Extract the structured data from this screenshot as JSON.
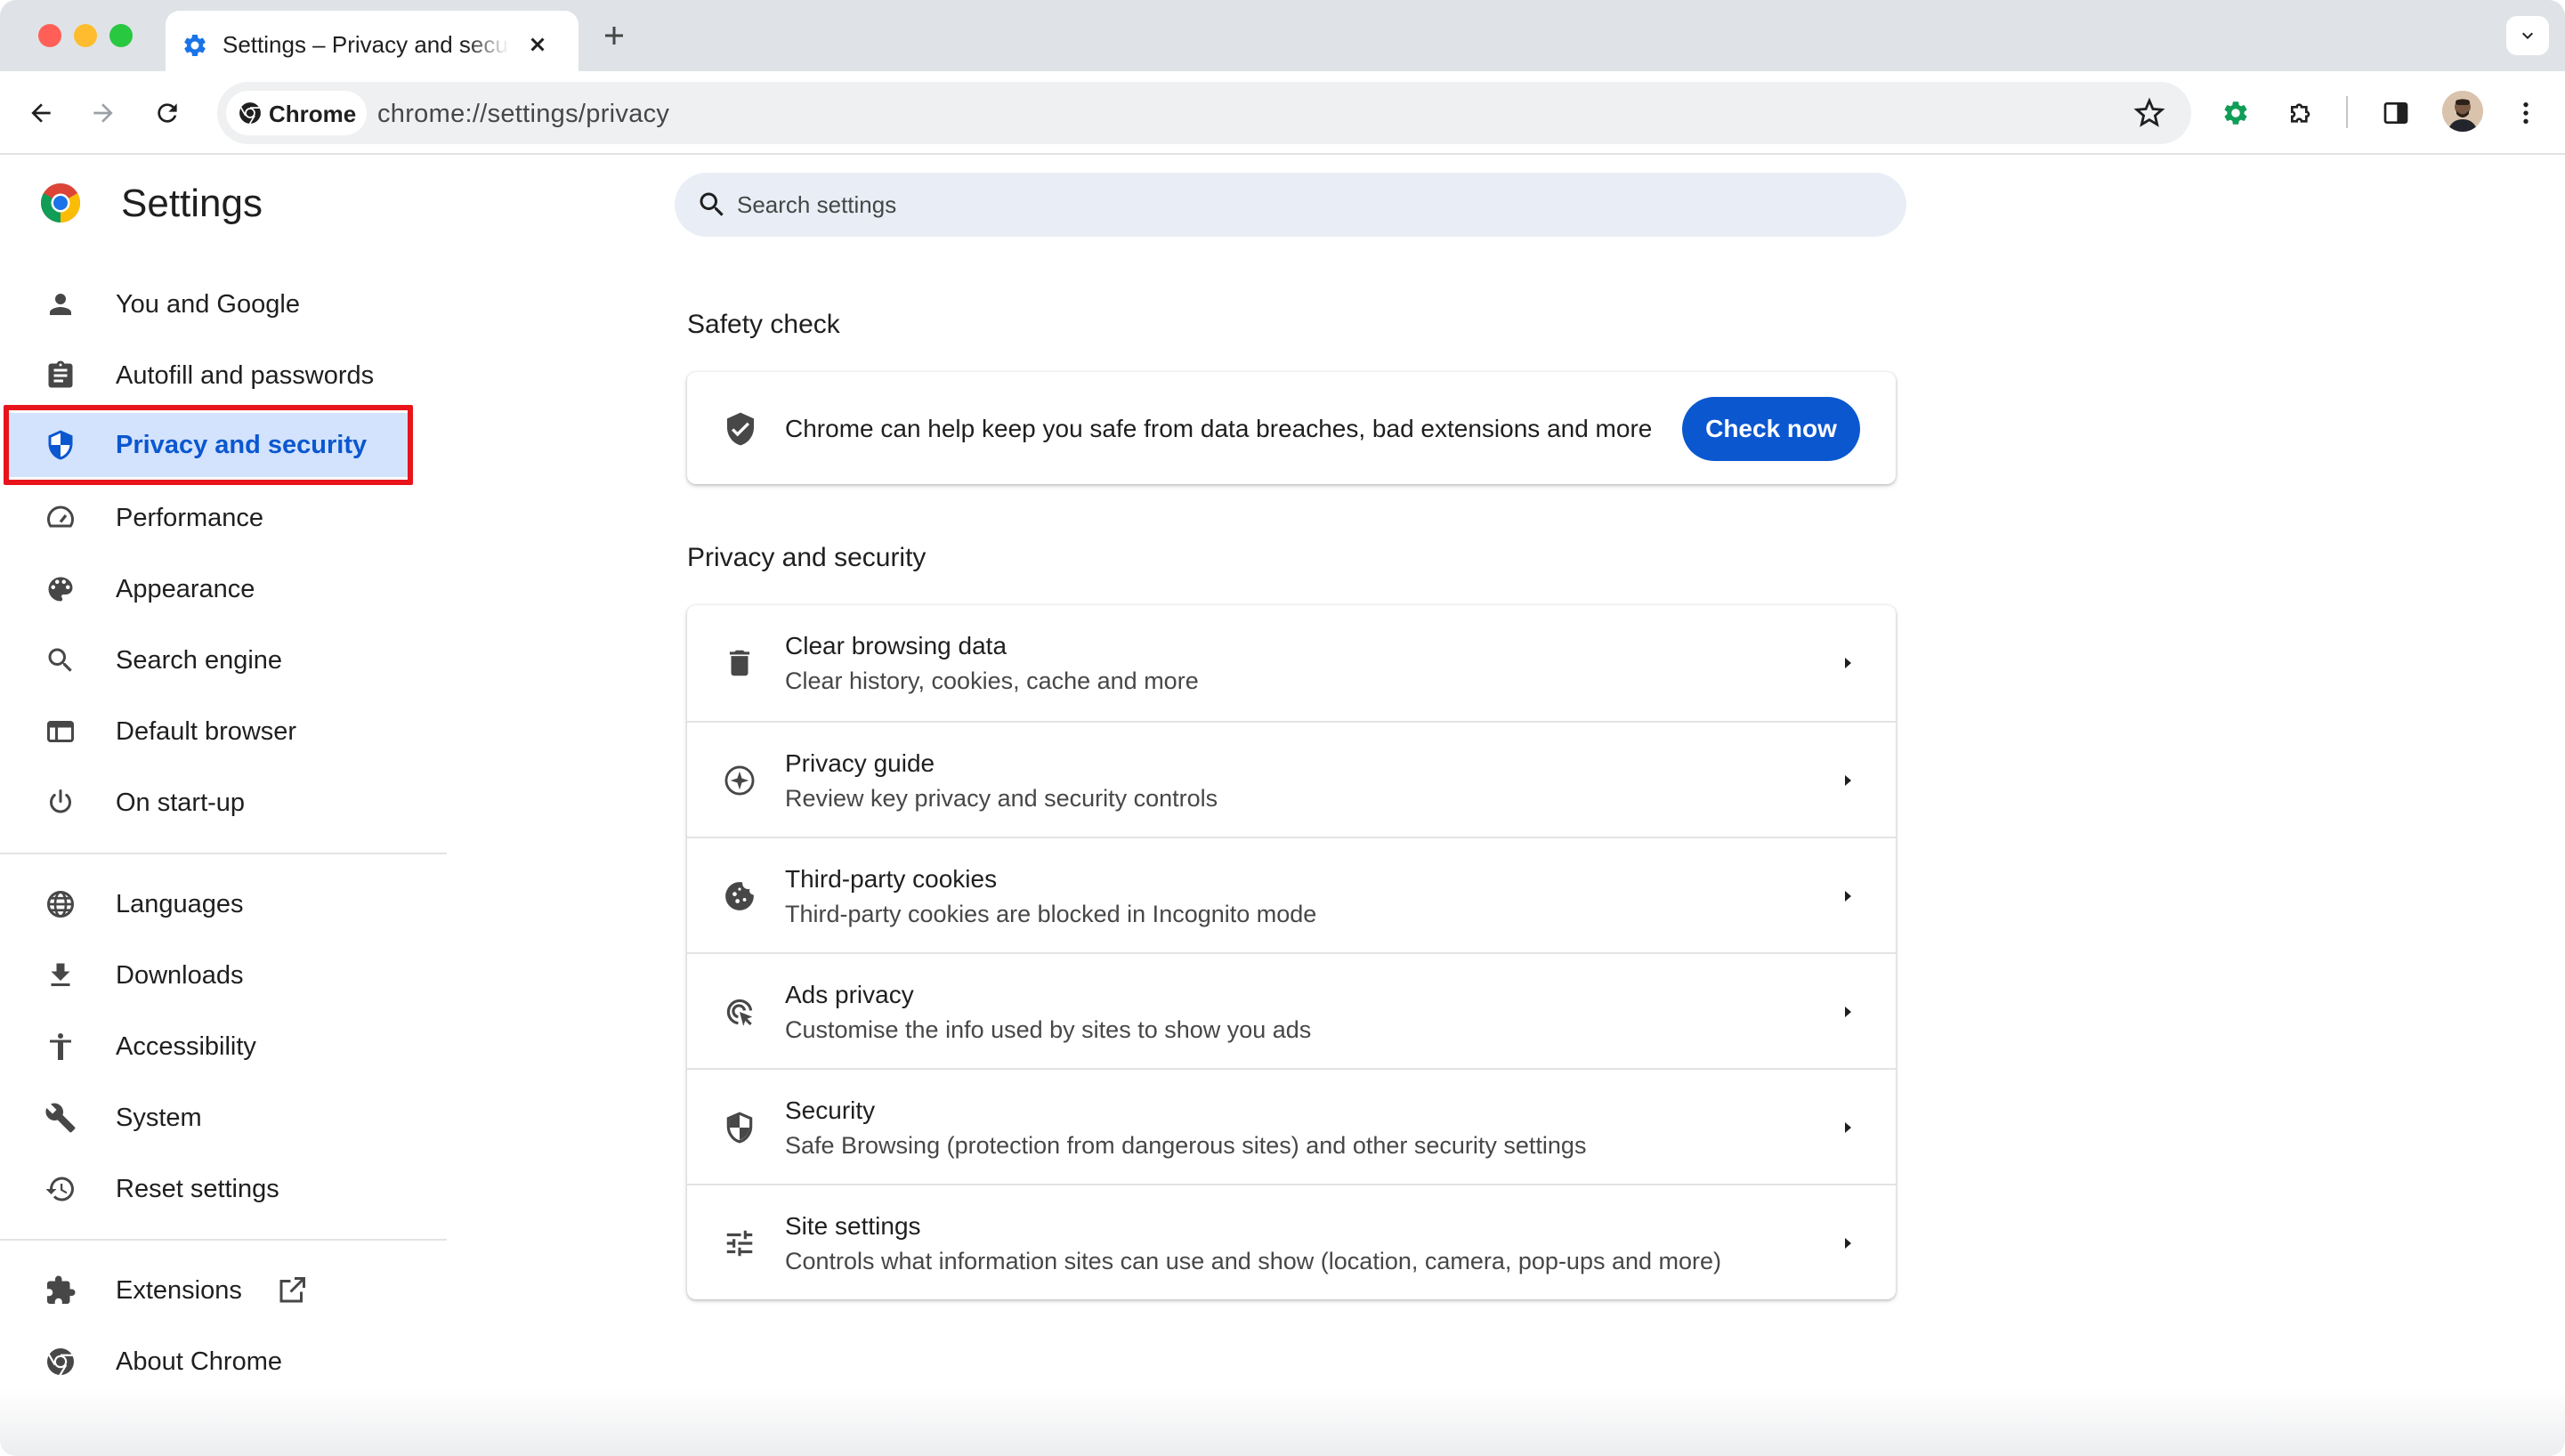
{
  "browser": {
    "tab_title": "Settings – Privacy and security",
    "address_chip": "Chrome",
    "url": "chrome://settings/privacy"
  },
  "settings": {
    "title": "Settings",
    "search_placeholder": "Search settings"
  },
  "sidebar": {
    "items": [
      {
        "label": "You and Google",
        "icon": "person-icon"
      },
      {
        "label": "Autofill and passwords",
        "icon": "clipboard-icon"
      },
      {
        "label": "Privacy and security",
        "icon": "shield-icon",
        "active": true
      },
      {
        "label": "Performance",
        "icon": "speedometer-icon"
      },
      {
        "label": "Appearance",
        "icon": "palette-icon"
      },
      {
        "label": "Search engine",
        "icon": "search-icon"
      },
      {
        "label": "Default browser",
        "icon": "browser-window-icon"
      },
      {
        "label": "On start-up",
        "icon": "power-icon"
      },
      {
        "label": "Languages",
        "icon": "globe-icon"
      },
      {
        "label": "Downloads",
        "icon": "download-icon"
      },
      {
        "label": "Accessibility",
        "icon": "accessibility-icon"
      },
      {
        "label": "System",
        "icon": "wrench-icon"
      },
      {
        "label": "Reset settings",
        "icon": "history-icon"
      },
      {
        "label": "Extensions",
        "icon": "puzzle-icon"
      },
      {
        "label": "About Chrome",
        "icon": "chrome-icon"
      }
    ]
  },
  "safety_check": {
    "heading": "Safety check",
    "text": "Chrome can help keep you safe from data breaches, bad extensions and more",
    "button": "Check now"
  },
  "privacy_section": {
    "heading": "Privacy and security",
    "rows": [
      {
        "title": "Clear browsing data",
        "subtitle": "Clear history, cookies, cache and more",
        "icon": "trash-icon"
      },
      {
        "title": "Privacy guide",
        "subtitle": "Review key privacy and security controls",
        "icon": "compass-icon"
      },
      {
        "title": "Third-party cookies",
        "subtitle": "Third-party cookies are blocked in Incognito mode",
        "icon": "cookie-icon"
      },
      {
        "title": "Ads privacy",
        "subtitle": "Customise the info used by sites to show you ads",
        "icon": "ads-target-icon"
      },
      {
        "title": "Security",
        "subtitle": "Safe Browsing (protection from dangerous sites) and other security settings",
        "icon": "shield-half-icon"
      },
      {
        "title": "Site settings",
        "subtitle": "Controls what information sites can use and show (location, camera, pop-ups and more)",
        "icon": "sliders-icon"
      }
    ]
  },
  "colors": {
    "accent": "#0b57d0",
    "active_nav_bg": "#d3e3fd",
    "highlight_box": "#e8141c"
  }
}
